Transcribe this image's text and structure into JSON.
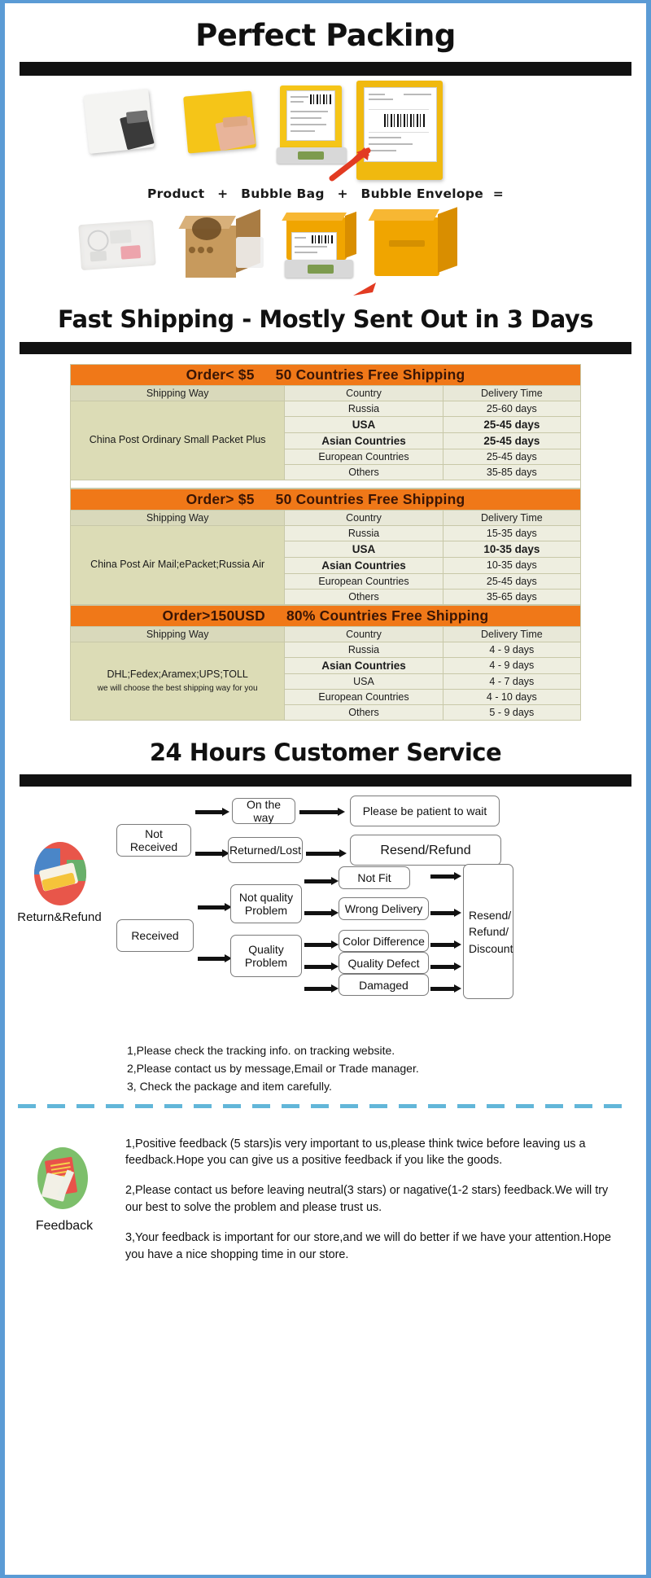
{
  "headings": {
    "packing": "Perfect Packing",
    "shipping": "Fast Shipping - Mostly Sent Out in 3 Days",
    "service": "24 Hours Customer Service"
  },
  "packing": {
    "equation_parts": [
      "Product",
      "+",
      "Bubble Bag",
      "+",
      "Bubble Envelope",
      "="
    ],
    "row1_alt": [
      "white poly mailer with product",
      "yellow bubble bag with product",
      "yellow bubble envelope on scale",
      "sealed yellow bubble envelope with label"
    ],
    "row2_alt": [
      "products in bubble wrap",
      "brown carton box with bubble filling",
      "yellow parcel on weighing scale",
      "sealed yellow parcel"
    ]
  },
  "shipping_tables": [
    {
      "banner_left": "Order< $5",
      "banner_right": "50 Countries Free Shipping",
      "headers": [
        "Shipping Way",
        "Country",
        "Delivery Time"
      ],
      "way": "China Post Ordinary Small Packet Plus",
      "way_sub": "",
      "rows": [
        {
          "country": "Russia",
          "bold_country": false,
          "time": "25-60 days",
          "bold_time": false
        },
        {
          "country": "USA",
          "bold_country": true,
          "time": "25-45 days",
          "bold_time": true
        },
        {
          "country": "Asian Countries",
          "bold_country": true,
          "time": "25-45 days",
          "bold_time": true
        },
        {
          "country": "European Countries",
          "bold_country": false,
          "time": "25-45 days",
          "bold_time": false
        },
        {
          "country": "Others",
          "bold_country": false,
          "time": "35-85 days",
          "bold_time": false
        }
      ]
    },
    {
      "banner_left": "Order> $5",
      "banner_right": "50 Countries  Free Shipping",
      "headers": [
        "Shipping Way",
        "Country",
        "Delivery Time"
      ],
      "way": "China Post Air Mail;ePacket;Russia Air",
      "way_sub": "",
      "rows": [
        {
          "country": "Russia",
          "bold_country": false,
          "time": "15-35 days",
          "bold_time": false
        },
        {
          "country": "USA",
          "bold_country": true,
          "time": "10-35 days",
          "bold_time": true
        },
        {
          "country": "Asian Countries",
          "bold_country": true,
          "time": "10-35 days",
          "bold_time": false
        },
        {
          "country": "European Countries",
          "bold_country": false,
          "time": "25-45 days",
          "bold_time": false
        },
        {
          "country": "Others",
          "bold_country": false,
          "time": "35-65 days",
          "bold_time": false
        }
      ]
    },
    {
      "banner_left": "Order>150USD",
      "banner_right": "80% Countries Free Shipping",
      "headers": [
        "Shipping Way",
        "Country",
        "Delivery Time"
      ],
      "way": "DHL;Fedex;Aramex;UPS;TOLL",
      "way_sub": "we will choose the best shipping way for you",
      "rows": [
        {
          "country": "Russia",
          "bold_country": false,
          "time": "4 - 9  days",
          "bold_time": false
        },
        {
          "country": "Asian Countries",
          "bold_country": true,
          "time": "4 - 9  days",
          "bold_time": false
        },
        {
          "country": "USA",
          "bold_country": false,
          "time": "4 - 7  days",
          "bold_time": false
        },
        {
          "country": "European Countries",
          "bold_country": false,
          "time": "4 - 10 days",
          "bold_time": false
        },
        {
          "country": "Others",
          "bold_country": false,
          "time": "5 - 9   days",
          "bold_time": false
        }
      ]
    }
  ],
  "flow": {
    "icon_label": "Return&Refund",
    "boxes": {
      "not_received": "Not Received",
      "on_the_way": "On the way",
      "please_wait": "Please be patient to wait",
      "returned_lost": "Returned/Lost",
      "resend_refund": "Resend/Refund",
      "received": "Received",
      "not_quality": "Not quality\nProblem",
      "quality": "Quality\nProblem",
      "not_fit": "Not Fit",
      "wrong_delivery": "Wrong Delivery",
      "color_difference": "Color Difference",
      "quality_defect": "Quality Defect",
      "damaged": "Damaged",
      "resend_refund_discount": "Resend/\nRefund/\nDiscount"
    },
    "notes": [
      "1,Please check the tracking info. on tracking website.",
      "2,Please contact us by message,Email or Trade manager.",
      "3, Check the package and item carefully."
    ]
  },
  "feedback": {
    "label": "Feedback",
    "paragraphs": [
      "1,Positive feedback (5 stars)is very important to us,please think twice before leaving us a feedback.Hope you can give us a positive feedback if you like the goods.",
      "2,Please contact us before leaving neutral(3 stars) or nagative(1-2 stars) feedback.We will try our best to solve the problem and please  trust us.",
      "3,Your feedback is important for our store,and we will do better if we have your attention.Hope you have a nice shopping time in our store."
    ]
  },
  "colors": {
    "border_blue": "#5b9bd5",
    "banner_orange": "#f07818",
    "table_olive": "#dcdcb6",
    "table_cream": "#eeeee0",
    "dashed_blue": "#62b6d9"
  }
}
